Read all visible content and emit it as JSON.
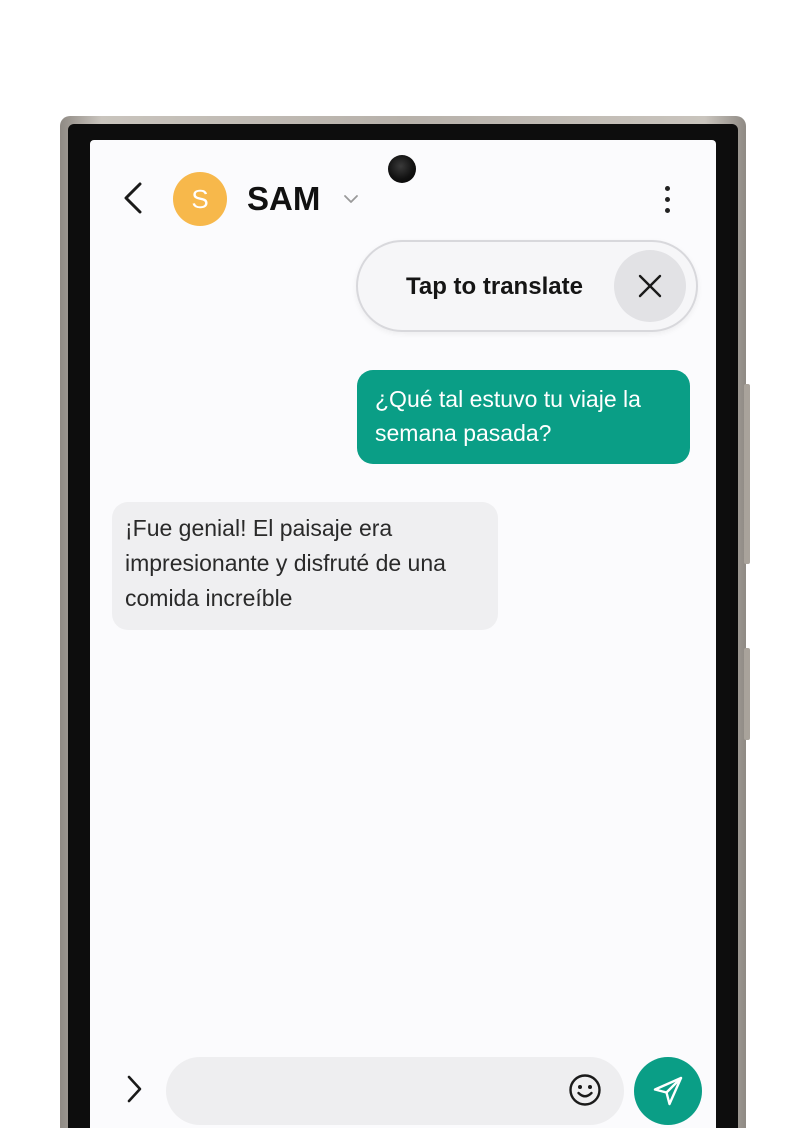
{
  "header": {
    "avatar_initial": "S",
    "contact_name": "SAM",
    "avatar_color": "#f7b84b",
    "icons": [
      "back-arrow-icon",
      "chevron-down-icon",
      "more-vertical-icon"
    ]
  },
  "translate_prompt": {
    "label": "Tap to translate",
    "close_icon": "close-icon"
  },
  "messages": [
    {
      "direction": "sent",
      "text": "¿Qué tal estuvo tu viaje la semana pasada?"
    },
    {
      "direction": "received",
      "text": "¡Fue genial! El paisaje era impresionante y disfruté de una comida increíble"
    }
  ],
  "composer": {
    "value": "",
    "placeholder": "",
    "icons": [
      "expand-chevron-icon",
      "emoji-icon",
      "send-icon"
    ]
  },
  "colors": {
    "accent": "#0a9e86",
    "received_bubble": "#efeff1",
    "screen_background": "#fbfbfd"
  }
}
